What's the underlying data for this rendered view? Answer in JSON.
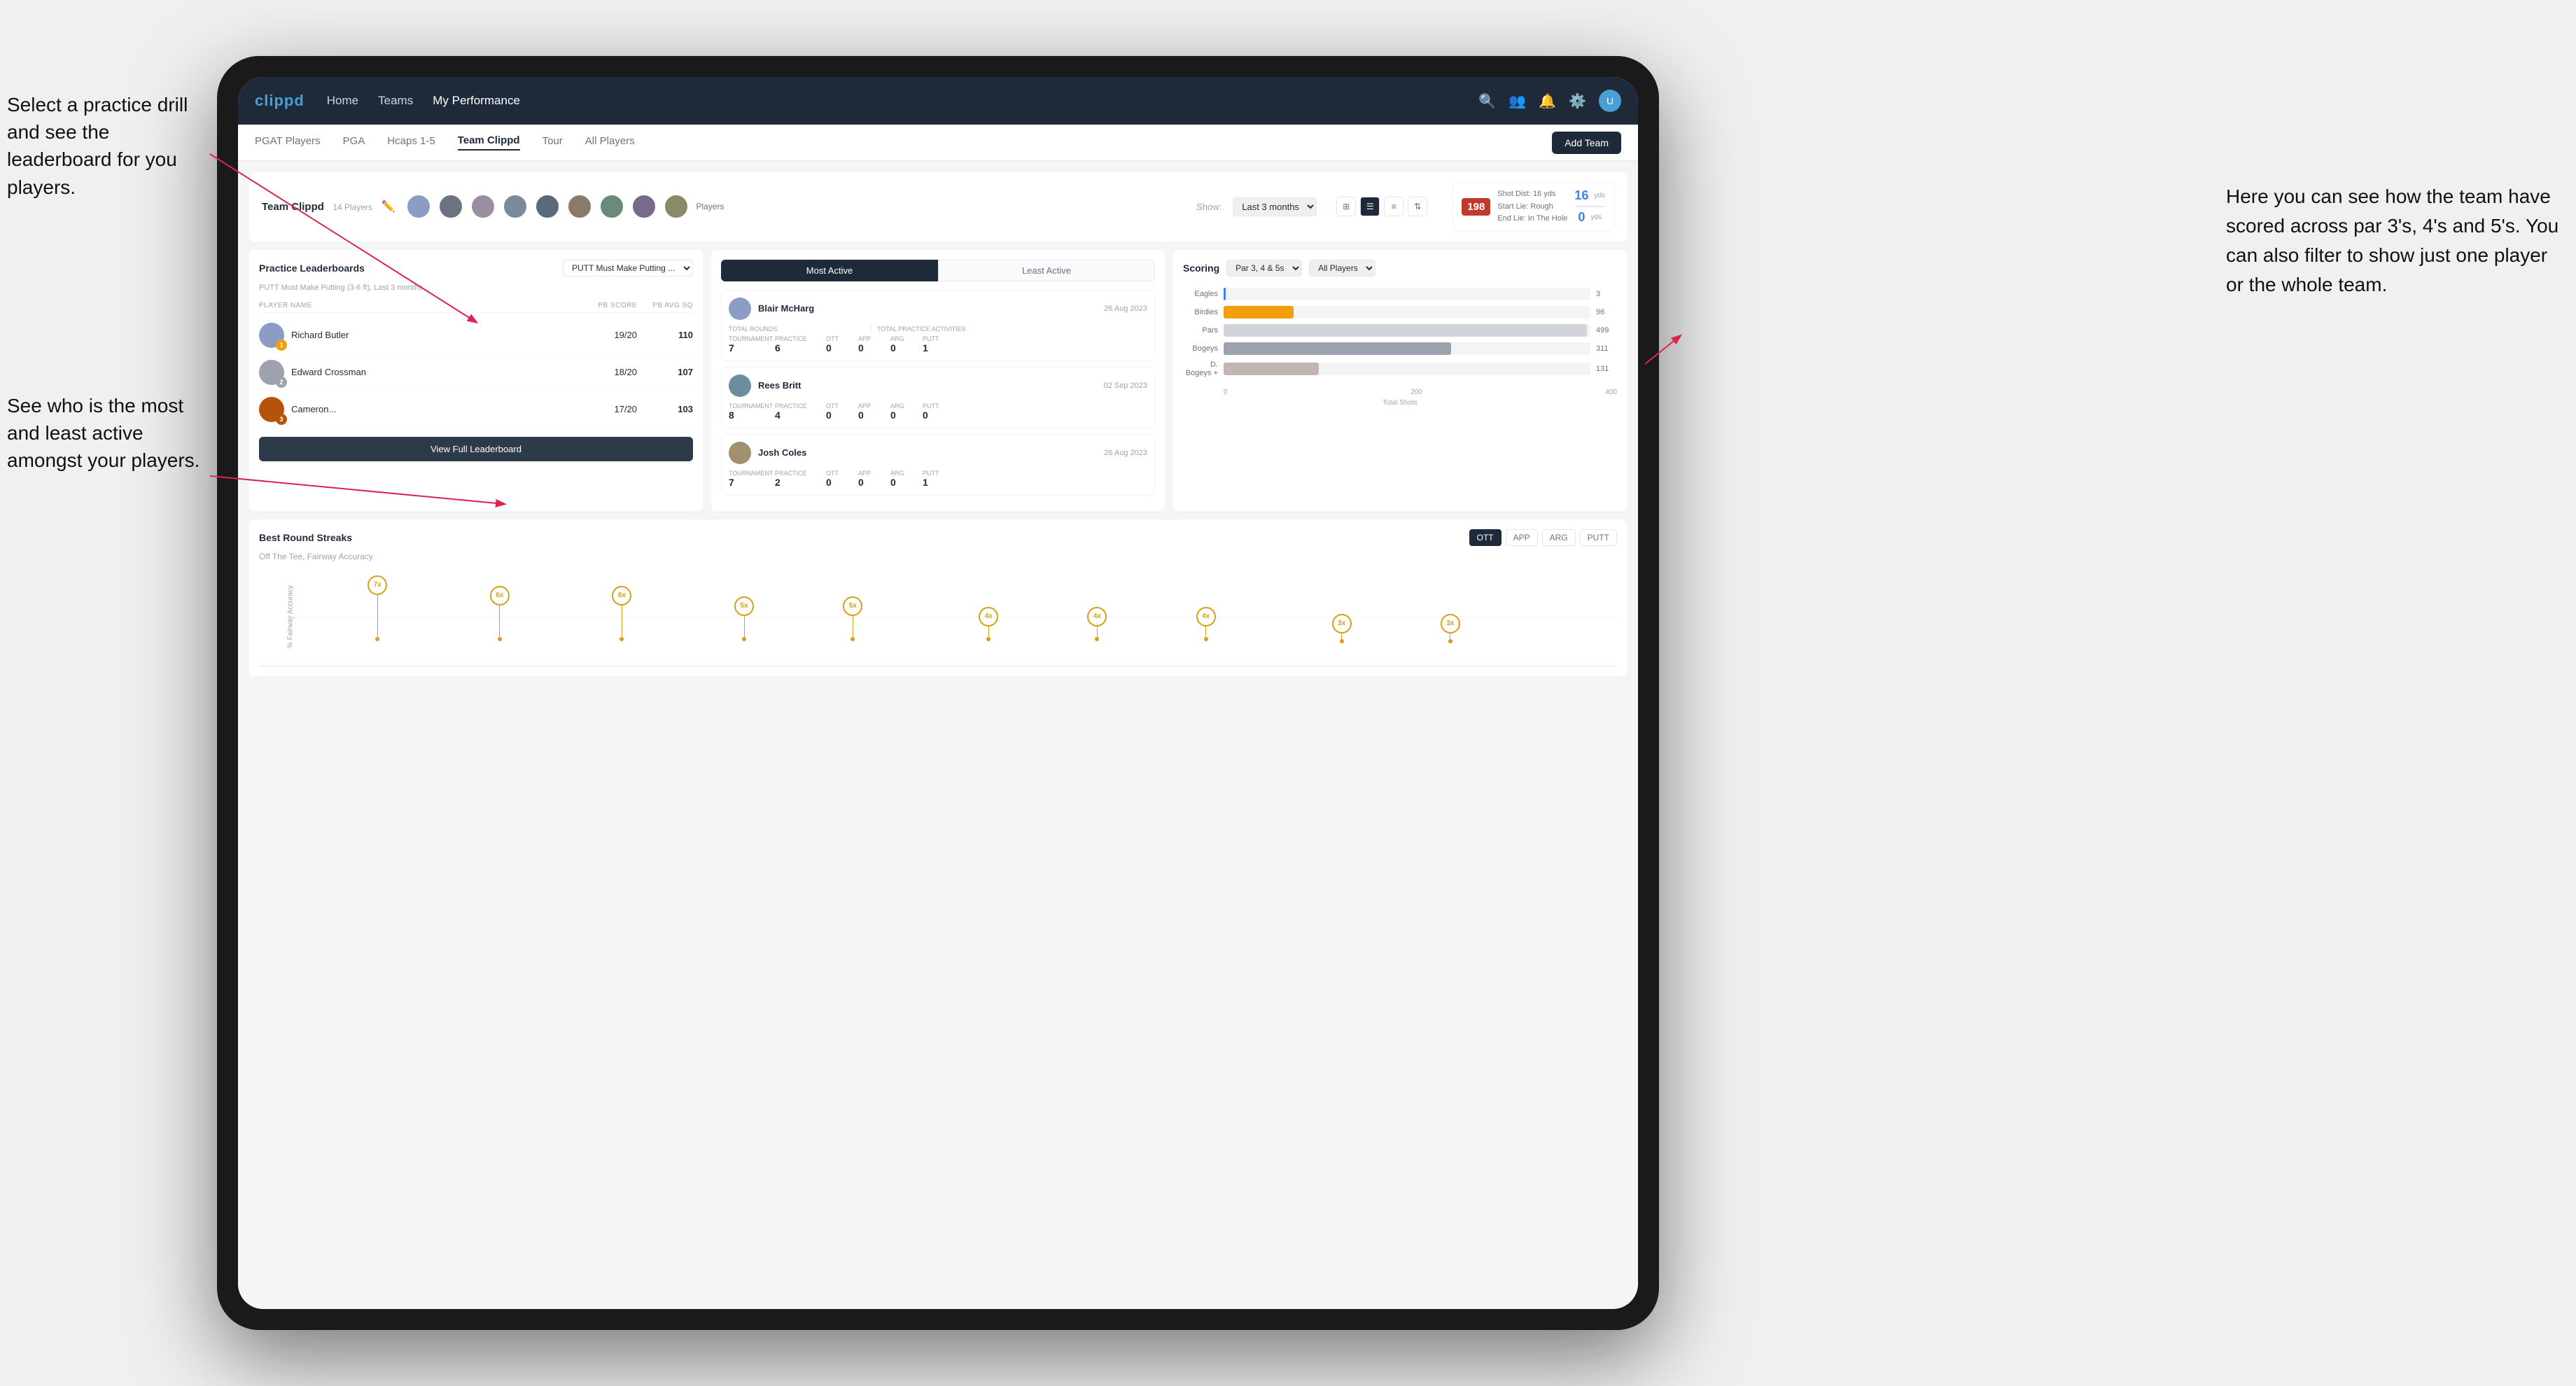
{
  "app": {
    "logo": "clippd",
    "nav": {
      "items": [
        "Home",
        "Teams",
        "My Performance"
      ],
      "icons": [
        "search",
        "people",
        "bell",
        "settings",
        "avatar"
      ]
    },
    "subnav": {
      "items": [
        "PGAT Players",
        "PGA",
        "Hcaps 1-5",
        "Team Clippd",
        "Tour",
        "All Players"
      ],
      "active": "Team Clippd",
      "add_team": "Add Team"
    }
  },
  "team": {
    "name": "Team Clippd",
    "player_count": "14 Players",
    "show_label": "Show:",
    "show_period": "Last 3 months",
    "players_label": "Players"
  },
  "shot_info": {
    "number": "198",
    "shot_dist_label": "Shot Dist:",
    "shot_dist_value": "16 yds",
    "start_lie_label": "Start Lie:",
    "start_lie_value": "Rough",
    "end_lie_label": "End Lie:",
    "end_lie_value": "In The Hole",
    "yds_left": "16",
    "yds_right": "0"
  },
  "practice_leaderboards": {
    "title": "Practice Leaderboards",
    "drill_select": "PUTT Must Make Putting ...",
    "subtitle": "PUTT Must Make Putting (3-6 ft), Last 3 months",
    "columns": {
      "player_name": "PLAYER NAME",
      "pb_score": "PB SCORE",
      "pb_avg_sq": "PB AVG SQ"
    },
    "players": [
      {
        "name": "Richard Butler",
        "score": "19/20",
        "avg": "110",
        "badge": "gold",
        "badge_num": "1"
      },
      {
        "name": "Edward Crossman",
        "score": "18/20",
        "avg": "107",
        "badge": "silver",
        "badge_num": "2"
      },
      {
        "name": "Cameron...",
        "score": "17/20",
        "avg": "103",
        "badge": "bronze",
        "badge_num": "3"
      }
    ],
    "view_full_btn": "View Full Leaderboard"
  },
  "activity": {
    "tabs": [
      "Most Active",
      "Least Active"
    ],
    "active_tab": "Most Active",
    "players": [
      {
        "name": "Blair McHarg",
        "date": "26 Aug 2023",
        "total_rounds_label": "Total Rounds",
        "tournament_label": "Tournament",
        "practice_label": "Practice",
        "tournament_val": "7",
        "practice_val": "6",
        "total_practice_label": "Total Practice Activities",
        "ott_label": "OTT",
        "app_label": "APP",
        "arg_label": "ARG",
        "putt_label": "PUTT",
        "ott_val": "0",
        "app_val": "0",
        "arg_val": "0",
        "putt_val": "1"
      },
      {
        "name": "Rees Britt",
        "date": "02 Sep 2023",
        "tournament_val": "8",
        "practice_val": "4",
        "ott_val": "0",
        "app_val": "0",
        "arg_val": "0",
        "putt_val": "0"
      },
      {
        "name": "Josh Coles",
        "date": "26 Aug 2023",
        "tournament_val": "7",
        "practice_val": "2",
        "ott_val": "0",
        "app_val": "0",
        "arg_val": "0",
        "putt_val": "1"
      }
    ]
  },
  "scoring": {
    "title": "Scoring",
    "filter1": "Par 3, 4 & 5s",
    "filter2": "All Players",
    "bars": [
      {
        "label": "Eagles",
        "value": 3,
        "max": 500,
        "color": "eagles",
        "display": "3"
      },
      {
        "label": "Birdies",
        "value": 96,
        "max": 500,
        "color": "birdies",
        "display": "96"
      },
      {
        "label": "Pars",
        "value": 499,
        "max": 500,
        "color": "pars",
        "display": "499"
      },
      {
        "label": "Bogeys",
        "value": 311,
        "max": 500,
        "color": "bogeys",
        "display": "311"
      },
      {
        "label": "D. Bogeys +",
        "value": 131,
        "max": 500,
        "color": "dbogeys",
        "display": "131"
      }
    ],
    "axis_values": [
      "0",
      "200",
      "400"
    ],
    "axis_label": "Total Shots"
  },
  "streaks": {
    "title": "Best Round Streaks",
    "subtitle": "Off The Tee, Fairway Accuracy",
    "tabs": [
      "OTT",
      "APP",
      "ARG",
      "PUTT"
    ],
    "active_tab": "OTT",
    "bubbles": [
      {
        "label": "7x",
        "x_pct": 7
      },
      {
        "label": "6x",
        "x_pct": 16
      },
      {
        "label": "6x",
        "x_pct": 25
      },
      {
        "label": "5x",
        "x_pct": 34
      },
      {
        "label": "5x",
        "x_pct": 42
      },
      {
        "label": "4x",
        "x_pct": 52
      },
      {
        "label": "4x",
        "x_pct": 60
      },
      {
        "label": "4x",
        "x_pct": 68
      },
      {
        "label": "3x",
        "x_pct": 78
      },
      {
        "label": "3x",
        "x_pct": 86
      }
    ]
  },
  "annotations": {
    "left_top": "Select a practice drill and see\nthe leaderboard for you players.",
    "left_bottom": "See who is the most and least\nactive amongst your players.",
    "right_top": "Here you can see how the\nteam have scored across\npar 3's, 4's and 5's.\n\nYou can also filter to show\njust one player or the whole\nteam.",
    "all_players": "AIl Players"
  }
}
